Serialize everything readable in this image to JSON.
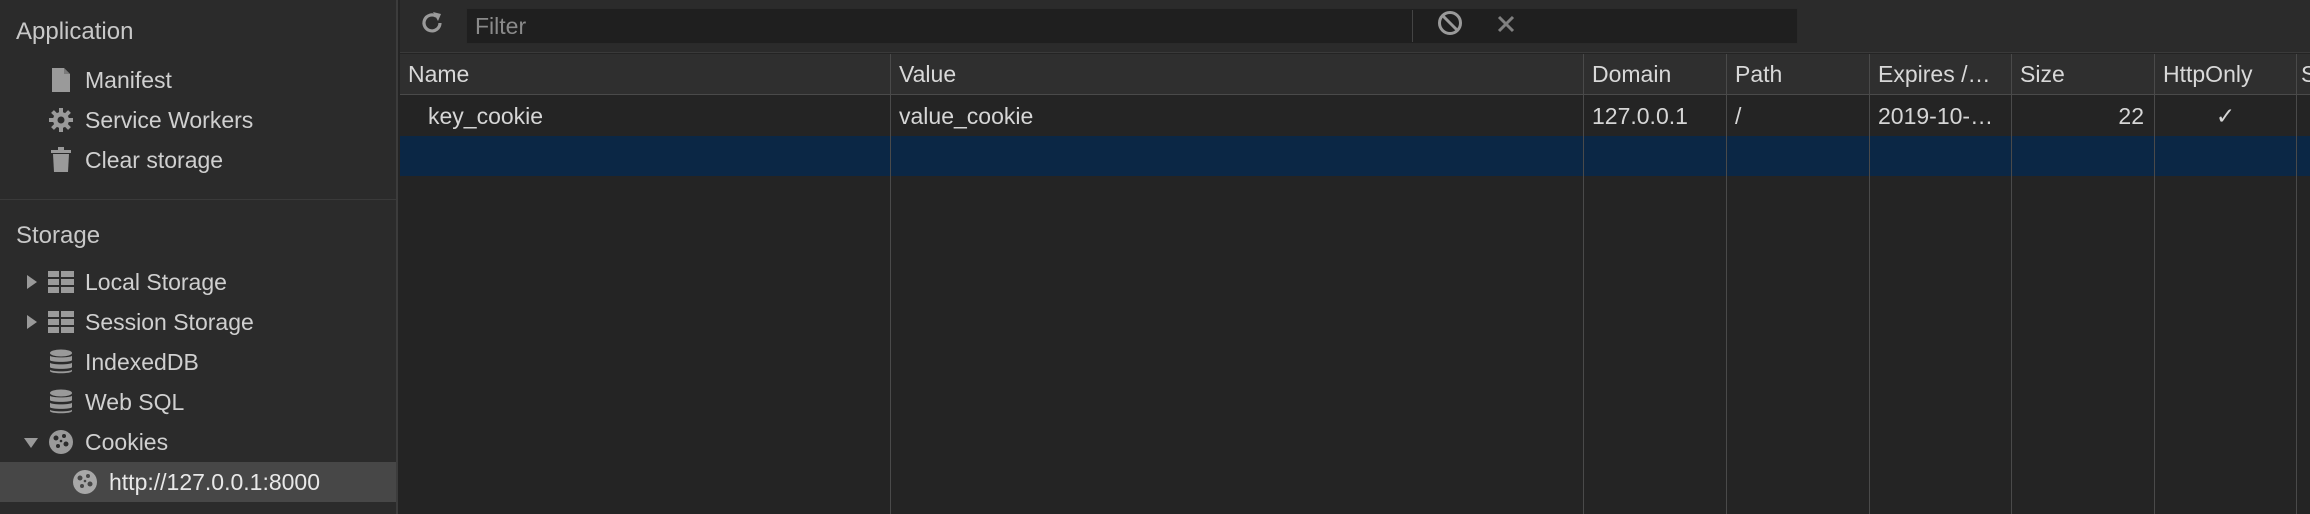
{
  "sidebar": {
    "application_title": "Application",
    "application_items": [
      {
        "label": "Manifest",
        "icon": "document-icon"
      },
      {
        "label": "Service Workers",
        "icon": "gear-icon"
      },
      {
        "label": "Clear storage",
        "icon": "trash-icon"
      }
    ],
    "storage_title": "Storage",
    "storage_items": [
      {
        "label": "Local Storage",
        "icon": "grid-icon",
        "expander": "collapsed"
      },
      {
        "label": "Session Storage",
        "icon": "grid-icon",
        "expander": "collapsed"
      },
      {
        "label": "IndexedDB",
        "icon": "database-icon"
      },
      {
        "label": "Web SQL",
        "icon": "database-icon"
      },
      {
        "label": "Cookies",
        "icon": "cookie-icon",
        "expander": "expanded"
      }
    ],
    "cookie_origin": {
      "label": "http://127.0.0.1:8000",
      "icon": "cookie-icon",
      "selected": true
    }
  },
  "toolbar": {
    "refresh_icon": "refresh-icon",
    "filter_placeholder": "Filter",
    "filter_value": "",
    "clear_all_icon": "block-icon",
    "delete_icon": "close-icon"
  },
  "table": {
    "columns": [
      "Name",
      "Value",
      "Domain",
      "Path",
      "Expires /…",
      "Size",
      "HttpOnly",
      "S"
    ],
    "rows": [
      {
        "name": "key_cookie",
        "value": "value_cookie",
        "domain": "127.0.0.1",
        "path": "/",
        "expires": "2019-10-…",
        "size": "22",
        "httponly": "✓"
      }
    ]
  },
  "colors": {
    "background": "#242424",
    "sidebar": "#2b2b2b",
    "selection": "#0b2745",
    "selected_sidebar_item": "#474747"
  }
}
